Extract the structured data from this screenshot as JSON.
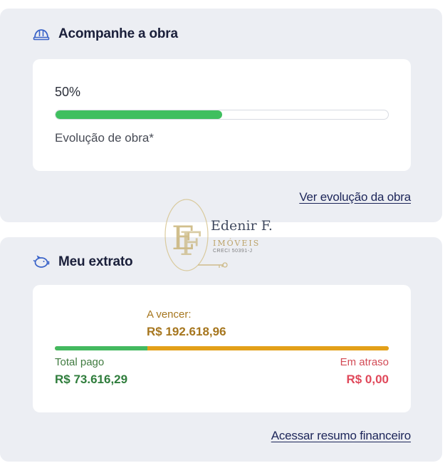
{
  "obra": {
    "title": "Acompanhe a obra",
    "icon": "helmet-icon",
    "percent_label": "50%",
    "progress_fraction": 0.5,
    "caption": "Evolução de obra*",
    "link_label": "Ver evolução da obra"
  },
  "extrato": {
    "title": "Meu extrato",
    "icon": "piggy-bank-icon",
    "a_vencer_label": "A vencer:",
    "a_vencer_value": "R$ 192.618,96",
    "total_pago_label": "Total pago",
    "total_pago_value": "R$ 73.616,29",
    "em_atraso_label": "Em atraso",
    "em_atraso_value": "R$ 0,00",
    "paid_fraction": 0.277,
    "link_label": "Acessar resumo financeiro"
  },
  "watermark": {
    "name": "Edenir F.",
    "sub": "IMÓVEIS",
    "creci": "CRECI 50391-J"
  },
  "colors": {
    "panel_bg": "#eceef3",
    "title": "#1a1f3a",
    "link": "#1c2559",
    "progress_green": "#3fbf5f",
    "due_gold": "#e3a019",
    "paid_green": "#2f7d3c",
    "overdue_red": "#e0485a"
  }
}
